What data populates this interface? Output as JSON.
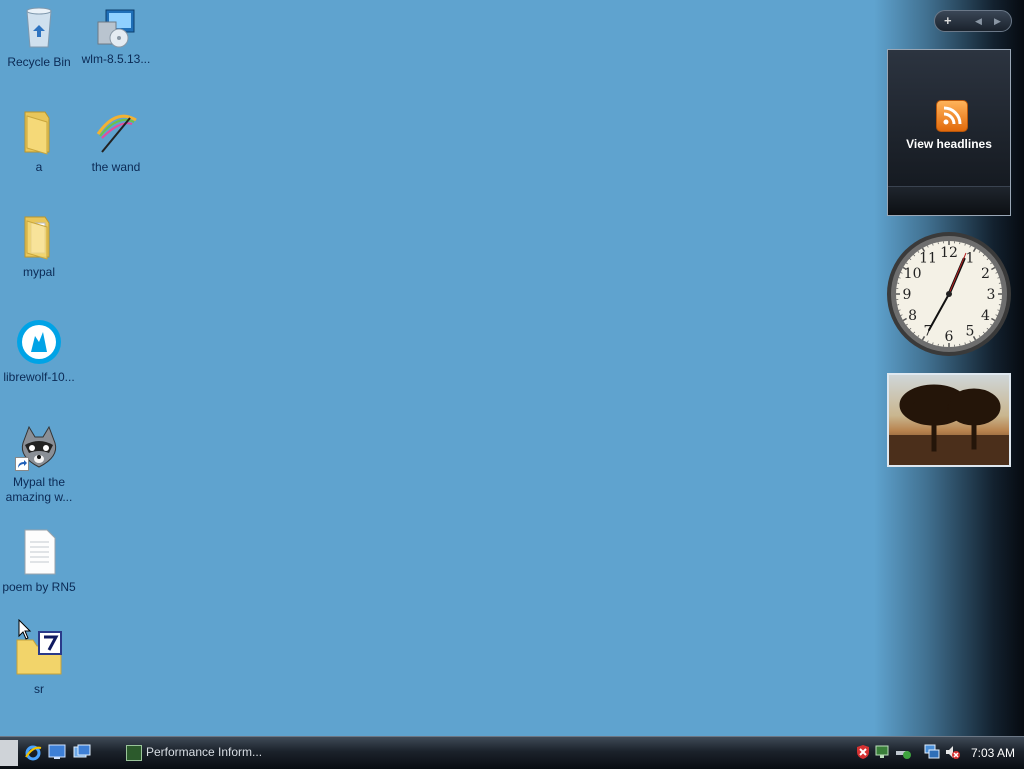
{
  "desktop": {
    "icons": [
      {
        "label": "Recycle Bin",
        "icon": "recycle-bin-icon"
      },
      {
        "label": "wlm-8.5.13...",
        "icon": "installer-icon"
      },
      {
        "label": "a",
        "icon": "folder-icon"
      },
      {
        "label": "the wand",
        "icon": "wand-icon"
      },
      {
        "label": "mypal",
        "icon": "folder-icon"
      },
      {
        "label": "librewolf-10...",
        "icon": "librewolf-icon"
      },
      {
        "label_line1": "Mypal the",
        "label_line2": "amazing w...",
        "icon": "mypal-icon"
      },
      {
        "label": "poem by RN5",
        "icon": "text-file-icon"
      },
      {
        "label": "sr",
        "icon": "archive-folder-icon"
      }
    ]
  },
  "sidebar": {
    "controls": {
      "add": "+",
      "prev": "◀",
      "next": "▶"
    },
    "news_gadget": {
      "label": "View headlines"
    },
    "clock_gadget": {
      "numbers": [
        "12",
        "1",
        "2",
        "3",
        "4",
        "5",
        "6",
        "7",
        "8",
        "9",
        "10",
        "11"
      ]
    },
    "photo_gadget": {
      "subject": "trees at sunset"
    }
  },
  "taskbar": {
    "task_label": "Performance Inform...",
    "time": "7:03 AM"
  },
  "colors": {
    "desktop": "#5fa3cf",
    "taskbar": "#1b222b",
    "label": "#0b2a55"
  }
}
